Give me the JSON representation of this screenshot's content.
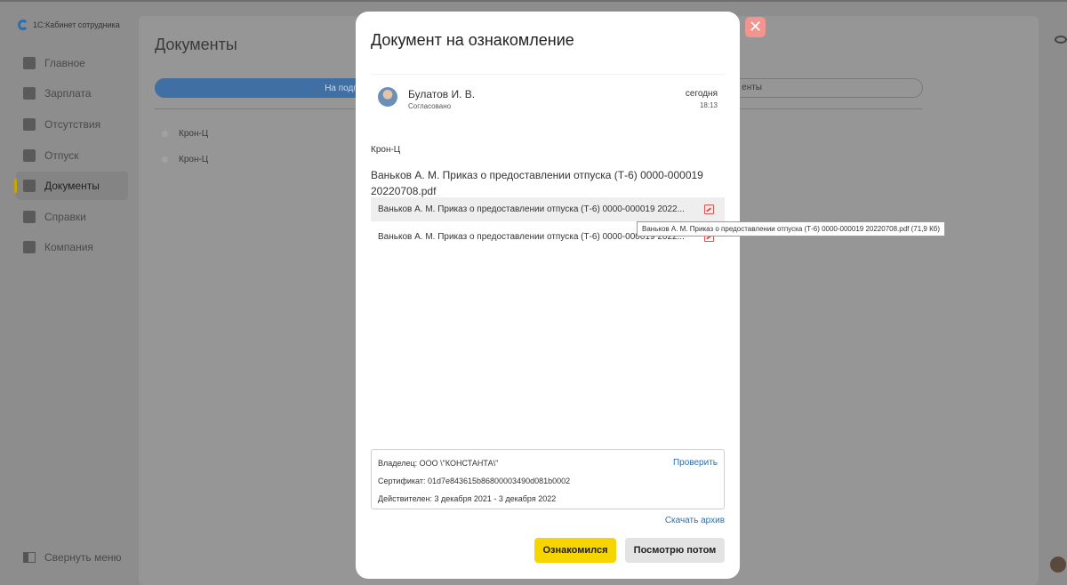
{
  "app": {
    "logo_text": "1С:Кабинет сотрудника"
  },
  "sidebar": {
    "items": [
      {
        "label": "Главное",
        "icon": "home-icon"
      },
      {
        "label": "Зарплата",
        "icon": "wallet-icon"
      },
      {
        "label": "Отсутствия",
        "icon": "calendar-icon"
      },
      {
        "label": "Отпуск",
        "icon": "plane-icon"
      },
      {
        "label": "Документы",
        "icon": "documents-icon",
        "active": true
      },
      {
        "label": "Справки",
        "icon": "certificate-icon"
      },
      {
        "label": "Компания",
        "icon": "people-icon"
      }
    ],
    "collapse_label": "Свернуть меню"
  },
  "background": {
    "page_title": "Документы",
    "tab_active": "На подп",
    "tab_right": "енты",
    "rows": [
      "Крон-Ц",
      "Крон-Ц"
    ]
  },
  "modal": {
    "title": "Документ на ознакомление",
    "approver": {
      "name": "Булатов И. В.",
      "status": "Согласовано",
      "date": "сегодня",
      "time": "18:13"
    },
    "organization": "Крон-Ц",
    "document_title": "Ваньков А. М. Приказ о предоставлении отпуска (Т-6) 0000-000019 20220708.pdf",
    "files": [
      {
        "name": "Ваньков А. М. Приказ о предоставлении отпуска (Т-6) 0000-000019 2022...",
        "icon": "pdf-icon"
      },
      {
        "name": "Ваньков А. М. Приказ о предоставлении отпуска (Т-6) 0000-000019 2022...",
        "icon": "pdf-icon"
      }
    ],
    "tooltip": "Ваньков А. М. Приказ о предоставлении отпуска (Т-6) 0000-000019 20220708.pdf (71,9 Кб)",
    "certificate": {
      "owner": "Владелец: ООО \\\"КОНСТАНТА\\\"",
      "serial": "Сертификат: 01d7e843615b86800003490d081b0002",
      "validity": "Действителен: 3 декабря 2021 - 3 декабря 2022",
      "verify_label": "Проверить"
    },
    "download_archive": "Скачать архив",
    "acknowledge_label": "Ознакомился",
    "later_label": "Посмотрю потом"
  },
  "colors": {
    "accent_yellow": "#f7d500",
    "link_blue": "#2a6fb0",
    "close_red": "#f0958f",
    "pdf_red": "#e0524c"
  }
}
